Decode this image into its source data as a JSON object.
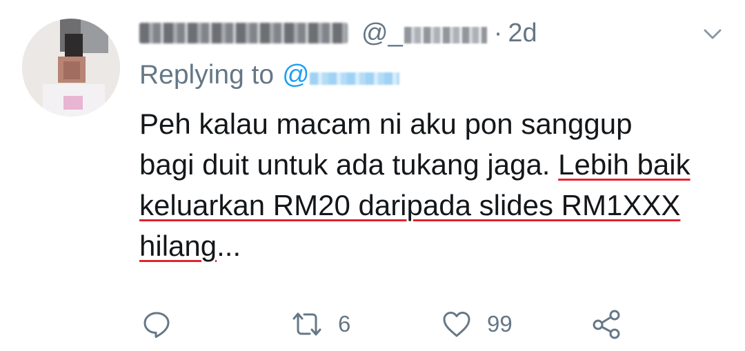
{
  "tweet": {
    "timestamp_separator": "·",
    "time": "2d",
    "handle_prefix": "@_",
    "replying_to_label": "Replying to",
    "replying_to_at": "@",
    "text_plain": "Peh kalau macam ni aku pon sanggup bagi duit untuk ada tukang jaga. ",
    "text_highlighted": "Lebih baik keluarkan RM20 daripada slides RM1XXX hilang",
    "text_trailing": "...",
    "icons": {
      "caret": "chevron-down-icon",
      "reply": "reply-icon",
      "retweet": "retweet-icon",
      "like": "heart-icon",
      "share": "share-icon"
    },
    "actions": {
      "retweet_count": "6",
      "like_count": "99"
    },
    "colors": {
      "secondary_text": "#657786",
      "link": "#1da1f2",
      "highlight_underline": "#e0242f"
    }
  }
}
